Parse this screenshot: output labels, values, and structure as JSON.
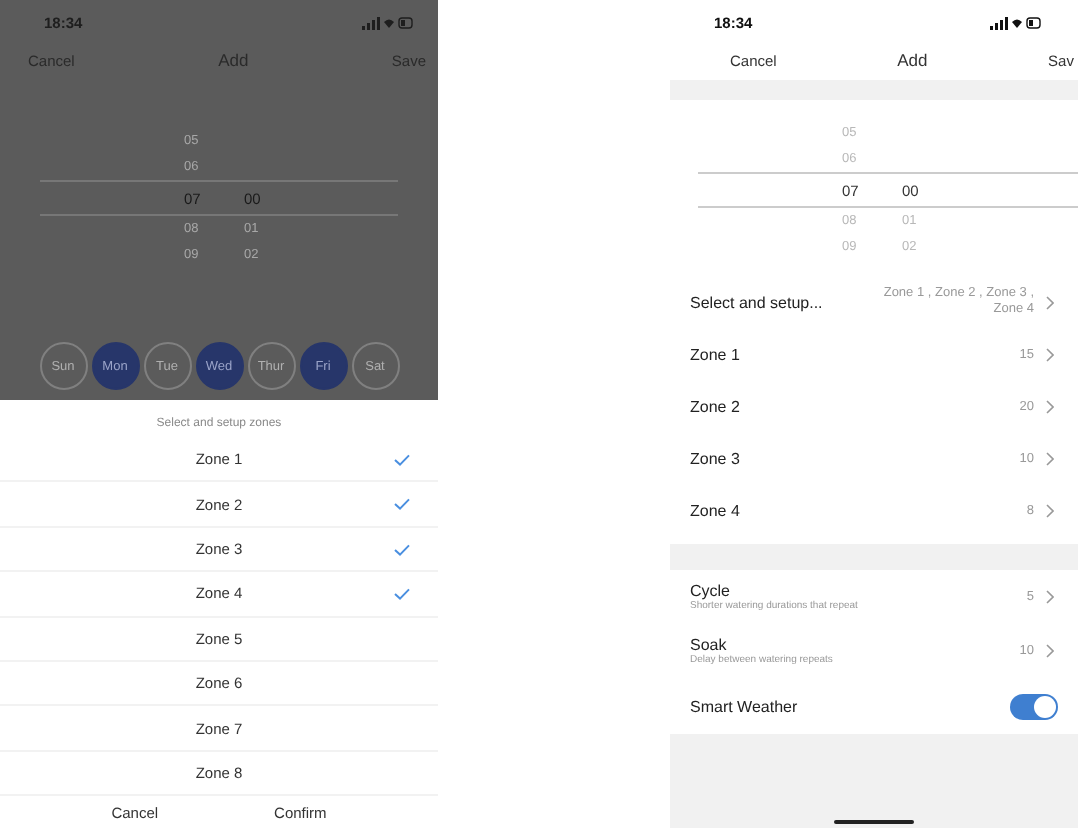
{
  "left_phone": {
    "status_bar": {
      "time": "18:34"
    },
    "nav": {
      "cancel": "Cancel",
      "title": "Add",
      "save": "Save"
    },
    "time_picker": [
      {
        "hour": "05",
        "selected": false
      },
      {
        "hour": "06",
        "selected": false
      },
      {
        "hour": "07",
        "minute": "00",
        "selected": true
      },
      {
        "hour": "08",
        "minute": "01",
        "selected": false
      },
      {
        "hour": "09",
        "minute": "02",
        "selected": false
      }
    ],
    "days": [
      {
        "label": "Sun",
        "selected": false
      },
      {
        "label": "Mon",
        "selected": true
      },
      {
        "label": "Tue",
        "selected": false
      },
      {
        "label": "Wed",
        "selected": true
      },
      {
        "label": "Thur",
        "selected": false
      },
      {
        "label": "Fri",
        "selected": true
      },
      {
        "label": "Sat",
        "selected": false
      }
    ],
    "zone_sheet": {
      "title": "Select and setup zones",
      "zones": [
        {
          "name": "Zone 1",
          "checked": true
        },
        {
          "name": "Zone 2",
          "checked": true
        },
        {
          "name": "Zone 3",
          "checked": true
        },
        {
          "name": "Zone 4",
          "checked": true
        },
        {
          "name": "Zone 5",
          "checked": false
        },
        {
          "name": "Zone 6",
          "checked": false
        },
        {
          "name": "Zone 7",
          "checked": false
        },
        {
          "name": "Zone 8",
          "checked": false
        }
      ],
      "buttons": [
        "Cancel",
        "Confirm"
      ]
    }
  },
  "right_phone": {
    "status_bar": {
      "time": "18:34"
    },
    "nav": {
      "cancel": "Cancel",
      "title": "Add",
      "save": "Sav"
    },
    "time_picker": [
      {
        "hour": "05",
        "selected": false
      },
      {
        "hour": "06",
        "selected": false
      },
      {
        "hour": "07",
        "minute": "00",
        "selected": true
      },
      {
        "hour": "08",
        "minute": "01",
        "selected": false
      },
      {
        "hour": "09",
        "minute": "02",
        "selected": false
      }
    ],
    "zone_select": {
      "label": "Select and setup...",
      "value": "Zone 1 , Zone 2 , Zone 3 , Zone 4"
    },
    "zones": [
      {
        "name": "Zone 1",
        "value": "15"
      },
      {
        "name": "Zone 2",
        "value": "20"
      },
      {
        "name": "Zone 3",
        "value": "10"
      },
      {
        "name": "Zone 4",
        "value": "8"
      }
    ],
    "settings": [
      {
        "kind": "value",
        "title": "Cycle",
        "subtitle": "Shorter watering durations that repeat",
        "value": "5"
      },
      {
        "kind": "value",
        "title": "Soak",
        "subtitle": "Delay between watering repeats",
        "value": "10"
      },
      {
        "kind": "toggle",
        "title": "Smart Weather",
        "on": true
      }
    ]
  }
}
